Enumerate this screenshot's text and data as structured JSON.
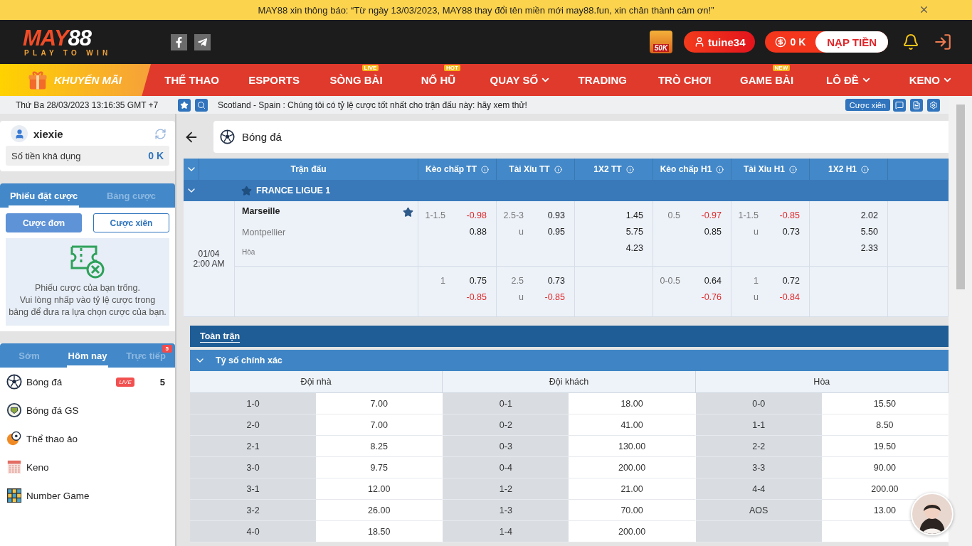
{
  "notice": {
    "text": "MAY88 xin thông báo: “Từ ngày 13/03/2023, MAY88 thay đổi tên miền mới may88.fun, xin chân thành cảm ơn!”"
  },
  "header": {
    "logo": {
      "part1": "MAY",
      "part2": "88",
      "slogan": "PLAY TO WIN"
    },
    "bonus_text": "50K",
    "user": "tuine34",
    "balance": "0 K",
    "deposit": "NẠP TIỀN"
  },
  "nav": [
    {
      "label": "KHUYẾN MÃI",
      "kind": "promo",
      "dropdown": false
    },
    {
      "label": "THỂ THAO",
      "kind": "link",
      "dropdown": false
    },
    {
      "label": "ESPORTS",
      "kind": "link",
      "dropdown": false
    },
    {
      "label": "SÒNG BÀI",
      "kind": "link",
      "dropdown": false,
      "badge": "LIVE"
    },
    {
      "label": "NỔ HŨ",
      "kind": "link",
      "dropdown": false,
      "badge": "HOT"
    },
    {
      "label": "QUAY SỐ",
      "kind": "link",
      "dropdown": true
    },
    {
      "label": "TRADING",
      "kind": "link",
      "dropdown": false
    },
    {
      "label": "TRÒ CHƠI",
      "kind": "link",
      "dropdown": false
    },
    {
      "label": "GAME BÀI",
      "kind": "link",
      "dropdown": false,
      "badge": "NEW"
    },
    {
      "label": "LÔ ĐỀ",
      "kind": "link",
      "dropdown": true
    },
    {
      "label": "KENO",
      "kind": "link",
      "dropdown": true
    }
  ],
  "subbar": {
    "datetime": "Thứ Ba 28/03/2023 13:16:35 GMT +7",
    "ticker": "Scotland - Spain : Chúng tôi có tỷ lệ cược tốt nhất cho trận đấu này: hãy xem thử!",
    "parlay_button": "Cược xiên"
  },
  "sidebar": {
    "account": {
      "name": "xiexie",
      "balance_label": "Số tiền khả dụng",
      "balance": "0 K"
    },
    "slip_tabs": [
      {
        "label": "Phiếu đặt cược",
        "selected": true
      },
      {
        "label": "Bảng cược",
        "selected": false
      }
    ],
    "bet_types": [
      {
        "label": "Cược đơn",
        "selected": true
      },
      {
        "label": "Cược xiên",
        "selected": false
      }
    ],
    "empty_message": "Phiếu cược của bạn trống.\nVui lòng nhấp vào tỷ lệ cược trong\nbảng để đưa ra lựa chọn cược của bạn.",
    "sport_tabs": [
      {
        "label": "Sớm",
        "selected": false
      },
      {
        "label": "Hôm nay",
        "selected": true
      },
      {
        "label": "Trực tiếp",
        "selected": false,
        "badge": "5"
      }
    ],
    "sports": [
      {
        "name": "Bóng đá",
        "badge": "LIVE",
        "count": "5"
      },
      {
        "name": "Bóng đá GS"
      },
      {
        "name": "Thể thao ảo"
      },
      {
        "name": "Keno"
      },
      {
        "name": "Number Game"
      }
    ]
  },
  "main": {
    "title": "Bóng đá",
    "columns": [
      "Trận đấu",
      "Kèo chấp TT",
      "Tài Xỉu TT",
      "1X2 TT",
      "Kèo chấp H1",
      "Tài Xỉu H1",
      "1X2 H1"
    ],
    "league": {
      "name": "FRANCE LIGUE 1",
      "favorite": true
    },
    "match": {
      "date": "01/04",
      "time": "2:00 AM",
      "home": "Marseille",
      "away": "Montpellier",
      "draw": "Hòa",
      "favorite": true,
      "lines": [
        {
          "hdp_ft": [
            {
              "label": "1-1.5",
              "value": "-0.98"
            },
            {
              "value": "0.88"
            }
          ],
          "ou_ft": [
            {
              "label": "2.5-3",
              "value": "0.93"
            },
            {
              "label": "u",
              "value": "0.95"
            }
          ],
          "x12_ft": [
            {
              "value": "1.45"
            },
            {
              "value": "5.75"
            },
            {
              "value": "4.23"
            }
          ],
          "hdp_h1": [
            {
              "label": "0.5",
              "value": "-0.97"
            },
            {
              "value": "0.85"
            }
          ],
          "ou_h1": [
            {
              "label": "1-1.5",
              "value": "-0.85"
            },
            {
              "label": "u",
              "value": "0.73"
            }
          ],
          "x12_h1": [
            {
              "value": "2.02"
            },
            {
              "value": "5.50"
            },
            {
              "value": "2.33"
            }
          ]
        },
        {
          "hdp_ft": [
            {
              "label": "1",
              "value": "0.75"
            },
            {
              "value": "-0.85"
            }
          ],
          "ou_ft": [
            {
              "label": "2.5",
              "value": "0.73"
            },
            {
              "label": "u",
              "value": "-0.85"
            }
          ],
          "hdp_h1": [
            {
              "label": "0-0.5",
              "value": "0.64"
            },
            {
              "value": "-0.76"
            }
          ],
          "ou_h1": [
            {
              "label": "1",
              "value": "0.72"
            },
            {
              "label": "u",
              "value": "-0.84"
            }
          ]
        }
      ]
    },
    "period_tabs": [
      {
        "label": "Toàn trận",
        "selected": true
      }
    ],
    "section": {
      "title": "Tỷ số chính xác",
      "columns": [
        "Đội nhà",
        "Đội khách",
        "Hòa"
      ],
      "rows": [
        {
          "home": {
            "score": "1-0",
            "odds": "7.00"
          },
          "away": {
            "score": "0-1",
            "odds": "18.00"
          },
          "draw": {
            "score": "0-0",
            "odds": "15.50"
          }
        },
        {
          "home": {
            "score": "2-0",
            "odds": "7.00"
          },
          "away": {
            "score": "0-2",
            "odds": "41.00"
          },
          "draw": {
            "score": "1-1",
            "odds": "8.50"
          }
        },
        {
          "home": {
            "score": "2-1",
            "odds": "8.25"
          },
          "away": {
            "score": "0-3",
            "odds": "130.00"
          },
          "draw": {
            "score": "2-2",
            "odds": "19.50"
          }
        },
        {
          "home": {
            "score": "3-0",
            "odds": "9.75"
          },
          "away": {
            "score": "0-4",
            "odds": "200.00"
          },
          "draw": {
            "score": "3-3",
            "odds": "90.00"
          }
        },
        {
          "home": {
            "score": "3-1",
            "odds": "12.00"
          },
          "away": {
            "score": "1-2",
            "odds": "21.00"
          },
          "draw": {
            "score": "4-4",
            "odds": "200.00"
          }
        },
        {
          "home": {
            "score": "3-2",
            "odds": "26.00"
          },
          "away": {
            "score": "1-3",
            "odds": "70.00"
          },
          "draw": {
            "score": "AOS",
            "odds": "13.00"
          }
        },
        {
          "home": {
            "score": "4-0",
            "odds": "18.50"
          },
          "away": {
            "score": "1-4",
            "odds": "200.00"
          }
        }
      ]
    }
  }
}
